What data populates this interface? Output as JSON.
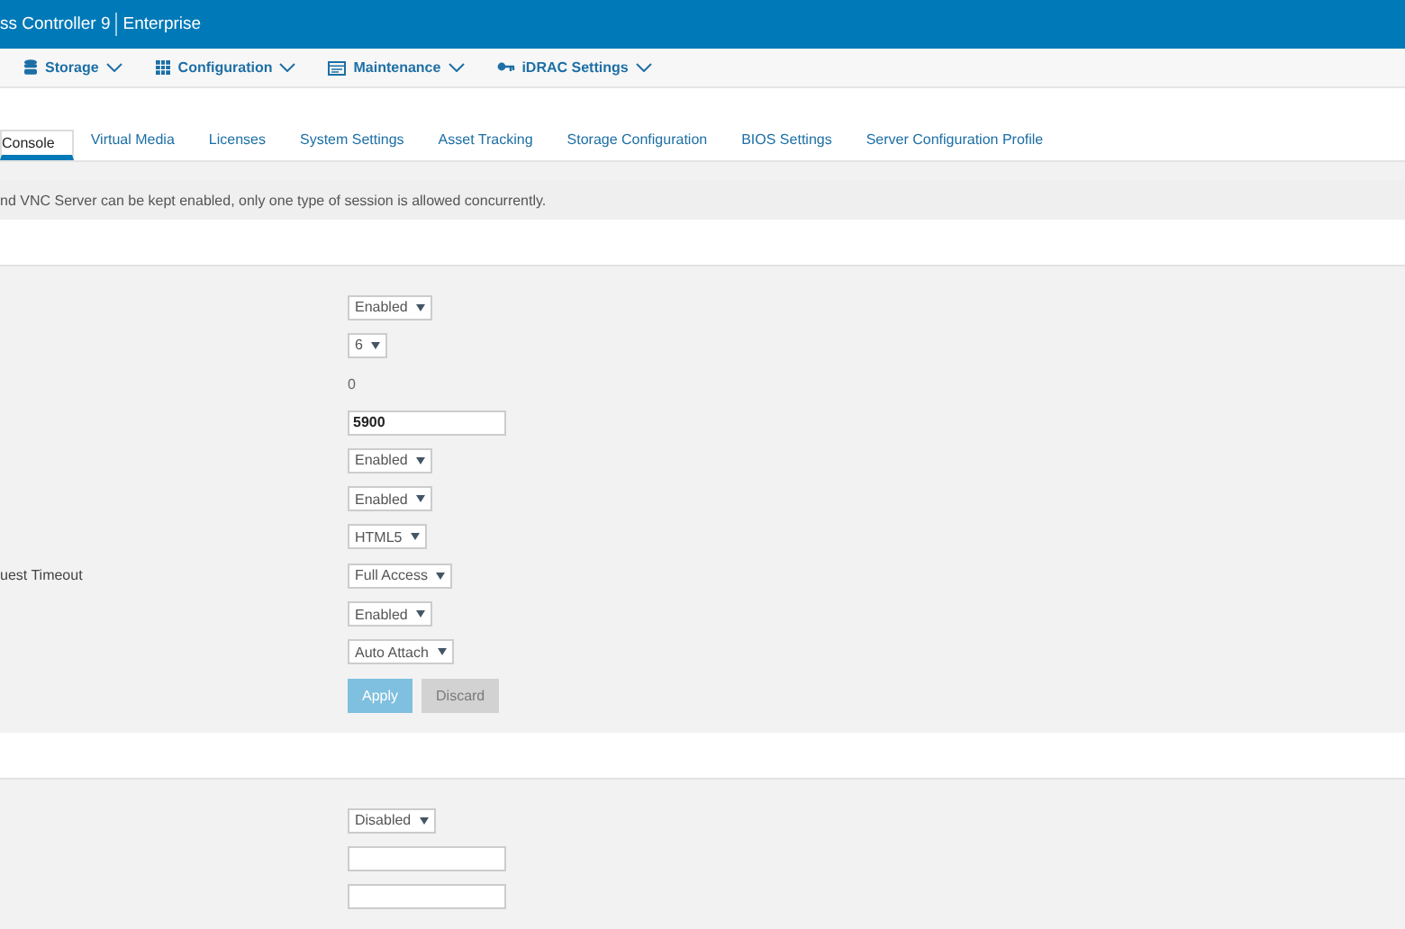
{
  "header": {
    "title": "ss Controller 9",
    "edition": "Enterprise"
  },
  "nav": [
    {
      "label": "Storage",
      "kind": "storage"
    },
    {
      "label": "Configuration",
      "kind": "configuration"
    },
    {
      "label": "Maintenance",
      "kind": "maintenance"
    },
    {
      "label": "iDRAC Settings",
      "kind": "settings"
    }
  ],
  "tabs": [
    {
      "label": "Console",
      "selected": true
    },
    {
      "label": "Virtual Media",
      "selected": false
    },
    {
      "label": "Licenses",
      "selected": false
    },
    {
      "label": "System Settings",
      "selected": false
    },
    {
      "label": "Asset Tracking",
      "selected": false
    },
    {
      "label": "Storage Configuration",
      "selected": false
    },
    {
      "label": "BIOS Settings",
      "selected": false
    },
    {
      "label": "Server Configuration Profile",
      "selected": false
    }
  ],
  "notice": "nd VNC Server can be kept enabled, only one type of session is allowed concurrently.",
  "section_1": {
    "rows": [
      {
        "kind": "select",
        "value": "Enabled"
      },
      {
        "kind": "select",
        "value": "6"
      },
      {
        "kind": "text",
        "value": "0"
      },
      {
        "kind": "input",
        "value": "5900"
      },
      {
        "kind": "select",
        "value": "Enabled"
      },
      {
        "kind": "select",
        "value": "Enabled"
      },
      {
        "kind": "select",
        "value": "HTML5"
      },
      {
        "kind": "select",
        "label": "uest Timeout",
        "value": "Full Access"
      },
      {
        "kind": "select",
        "value": "Enabled"
      },
      {
        "kind": "select",
        "value": "Auto Attach"
      }
    ],
    "buttons": [
      {
        "label": "Apply",
        "kind": "primary"
      },
      {
        "label": "Discard",
        "kind": "secondary"
      }
    ]
  },
  "section_2": {
    "rows": [
      {
        "kind": "select",
        "value": "Disabled"
      },
      {
        "kind": "input"
      },
      {
        "kind": "input"
      }
    ]
  }
}
